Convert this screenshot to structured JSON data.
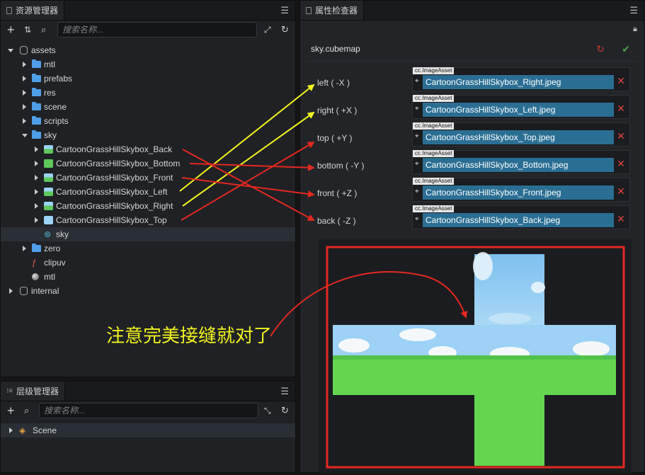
{
  "assets_panel": {
    "title": "资源管理器",
    "search_placeholder": "搜索名称...",
    "tree": [
      {
        "label": "assets"
      },
      {
        "label": "mtl"
      },
      {
        "label": "prefabs"
      },
      {
        "label": "res"
      },
      {
        "label": "scene"
      },
      {
        "label": "scripts"
      },
      {
        "label": "sky"
      },
      {
        "label": "CartoonGrassHillSkybox_Back"
      },
      {
        "label": "CartoonGrassHillSkybox_Bottom"
      },
      {
        "label": "CartoonGrassHillSkybox_Front"
      },
      {
        "label": "CartoonGrassHillSkybox_Left"
      },
      {
        "label": "CartoonGrassHillSkybox_Right"
      },
      {
        "label": "CartoonGrassHillSkybox_Top"
      },
      {
        "label": "sky"
      },
      {
        "label": "zero"
      },
      {
        "label": "clipuv"
      },
      {
        "label": "mtl"
      },
      {
        "label": "internal"
      }
    ]
  },
  "hierarchy_panel": {
    "title": "层级管理器",
    "search_placeholder": "搜索名称...",
    "scene_label": "Scene"
  },
  "inspector": {
    "title": "属性检查器",
    "asset_name": "sky.cubemap",
    "faces": [
      {
        "label": "left ( -X )",
        "type": "cc.ImageAsset",
        "value": "CartoonGrassHillSkybox_Right.jpeg"
      },
      {
        "label": "right ( +X )",
        "type": "cc.ImageAsset",
        "value": "CartoonGrassHillSkybox_Left.jpeg"
      },
      {
        "label": "top ( +Y )",
        "type": "cc.ImageAsset",
        "value": "CartoonGrassHillSkybox_Top.jpeg"
      },
      {
        "label": "bottom ( -Y )",
        "type": "cc.ImageAsset",
        "value": "CartoonGrassHillSkybox_Bottom.jpeg"
      },
      {
        "label": "front ( +Z )",
        "type": "cc.ImageAsset",
        "value": "CartoonGrassHillSkybox_Front.jpeg"
      },
      {
        "label": "back ( -Z )",
        "type": "cc.ImageAsset",
        "value": "CartoonGrassHillSkybox_Back.jpeg"
      }
    ]
  },
  "annotation": {
    "text": "注意完美接缝就对了"
  },
  "colors": {
    "accent_blue": "#2b6e94",
    "annotation_yellow": "#f2f21e",
    "annotation_red": "#e4281f",
    "folder_blue": "#4f9ee8"
  }
}
